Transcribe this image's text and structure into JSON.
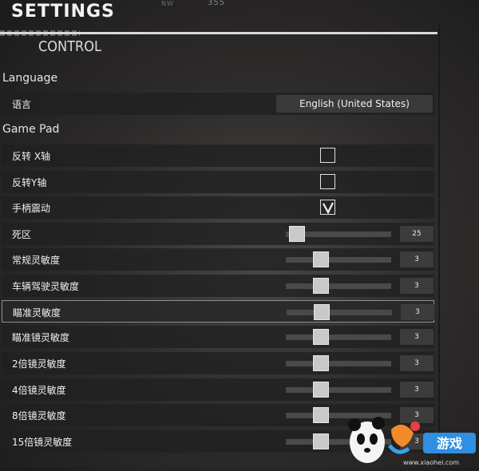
{
  "compass": {
    "heading": "355",
    "marker": "NW"
  },
  "header": {
    "title": "SETTINGS",
    "subtitle": "CONTROL"
  },
  "language": {
    "section_label": "Language",
    "row_label": "语言",
    "selected": "English (United States)"
  },
  "gamepad": {
    "section_label": "Game Pad",
    "checkboxes": [
      {
        "label": "反转 X轴",
        "checked": false
      },
      {
        "label": "反转Y轴",
        "checked": false
      },
      {
        "label": "手柄震动",
        "checked": true
      }
    ],
    "sliders": [
      {
        "label": "死区",
        "value": "25",
        "level": 0.25
      },
      {
        "label": "常规灵敏度",
        "value": "3",
        "level": 0.3
      },
      {
        "label": "车辆驾驶灵敏度",
        "value": "3",
        "level": 0.3
      },
      {
        "label": "瞄准灵敏度",
        "value": "3",
        "level": 0.3
      },
      {
        "label": "瞄准镜灵敏度",
        "value": "3",
        "level": 0.3
      },
      {
        "label": "2倍镜灵敏度",
        "value": "3",
        "level": 0.3
      },
      {
        "label": "4倍镜灵敏度",
        "value": "3",
        "level": 0.3
      },
      {
        "label": "8倍镜灵敏度",
        "value": "3",
        "level": 0.3
      },
      {
        "label": "15倍镜灵敏度",
        "value": "3",
        "level": 0.3
      }
    ]
  },
  "watermark": {
    "brand": "游戏",
    "url": "www.xiaohei.com"
  },
  "colors": {
    "row_bg": "#202020",
    "accent_rule": "#d9d9d9",
    "thumb": "#c9c9c9"
  }
}
